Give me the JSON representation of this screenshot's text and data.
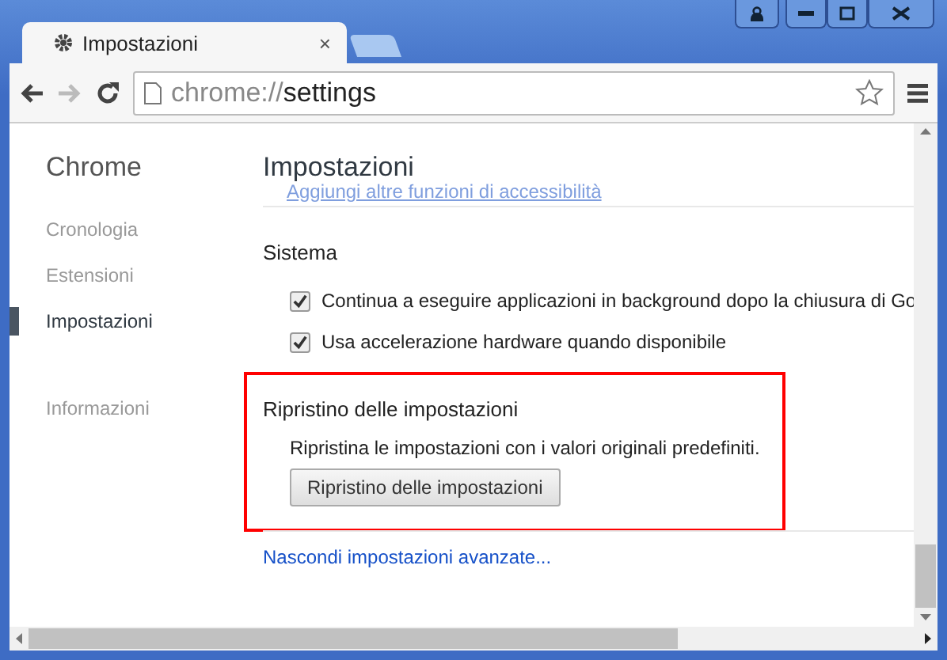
{
  "tabs": [
    {
      "title": "Impostazioni",
      "selected": true,
      "close": "×"
    }
  ],
  "address": {
    "scheme": "chrome://",
    "path": "settings"
  },
  "sidebar": {
    "title": "Chrome",
    "items": [
      {
        "label": "Cronologia",
        "selected": false
      },
      {
        "label": "Estensioni",
        "selected": false
      },
      {
        "label": "Impostazioni",
        "selected": true
      },
      {
        "label": "Informazioni",
        "selected": false
      }
    ]
  },
  "page": {
    "title": "Impostazioni",
    "faded_link": "Aggiungi altre funzioni di accessibilità",
    "sections": [
      {
        "kind": "checks",
        "title": "Sistema",
        "options": [
          {
            "label": "Continua a eseguire applicazioni in background dopo la chiusura di Go",
            "checked": true
          },
          {
            "label": "Usa accelerazione hardware quando disponibile",
            "checked": true
          }
        ]
      },
      {
        "kind": "reset",
        "title": "Ripristino delle impostazioni",
        "highlighted": true,
        "description": "Ripristina le impostazioni con i valori originali predefiniti.",
        "button": "Ripristino delle impostazioni"
      }
    ],
    "footer_link": "Nascondi impostazioni avanzate..."
  }
}
